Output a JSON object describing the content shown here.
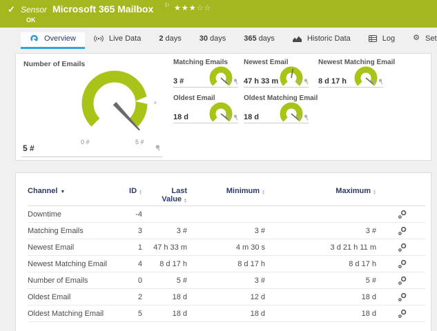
{
  "colors": {
    "brand_green": "#a5b71f",
    "gauge_green": "#a9c319",
    "accent_blue": "#35a3dc",
    "table_header_text": "#2b3a66"
  },
  "sensor_header": {
    "check": "✓",
    "type_label": "Sensor",
    "title": "Microsoft 365 Mailbox",
    "flag": "⚐",
    "stars_filled": "★★★",
    "stars_empty": "☆☆",
    "status": "OK"
  },
  "tabs": [
    {
      "num": "",
      "text": "Overview"
    },
    {
      "num": "",
      "text": "Live Data"
    },
    {
      "num": "2",
      "text": "days"
    },
    {
      "num": "30",
      "text": "days"
    },
    {
      "num": "365",
      "text": "days"
    },
    {
      "num": "",
      "text": "Historic Data"
    },
    {
      "num": "",
      "text": "Log"
    },
    {
      "num": "",
      "text": "Settings"
    }
  ],
  "gauges": {
    "main": {
      "title": "Number of Emails",
      "value": "5 #",
      "scale_min": "0 #",
      "scale_max": "5 #",
      "marker_label": "x",
      "needle_deg": 47
    },
    "minis": [
      {
        "title": "Matching Emails",
        "value": "3 #",
        "needle_deg": 42
      },
      {
        "title": "Newest Email",
        "value": "47 h 33 m",
        "needle_deg": -80
      },
      {
        "title": "Newest Matching Email",
        "value": "8 d 17 h",
        "needle_deg": 40
      },
      {
        "title": "Oldest Email",
        "value": "18 d",
        "needle_deg": 38
      },
      {
        "title": "Oldest Matching Email",
        "value": "18 d",
        "needle_deg": 40
      }
    ]
  },
  "table": {
    "columns": [
      "Channel",
      "ID",
      "Last Value",
      "Minimum",
      "Maximum"
    ],
    "rows": [
      {
        "channel": "Downtime",
        "id": "-4",
        "last": "",
        "min": "",
        "max": ""
      },
      {
        "channel": "Matching Emails",
        "id": "3",
        "last": "3 #",
        "min": "3 #",
        "max": "3 #"
      },
      {
        "channel": "Newest Email",
        "id": "1",
        "last": "47 h 33 m",
        "min": "4 m 30 s",
        "max": "3 d 21 h 11 m"
      },
      {
        "channel": "Newest Matching Email",
        "id": "4",
        "last": "8 d 17 h",
        "min": "8 d 17 h",
        "max": "8 d 17 h"
      },
      {
        "channel": "Number of Emails",
        "id": "0",
        "last": "5 #",
        "min": "3 #",
        "max": "5 #"
      },
      {
        "channel": "Oldest Email",
        "id": "2",
        "last": "18 d",
        "min": "12 d",
        "max": "18 d"
      },
      {
        "channel": "Oldest Matching Email",
        "id": "5",
        "last": "18 d",
        "min": "18 d",
        "max": "18 d"
      }
    ]
  }
}
